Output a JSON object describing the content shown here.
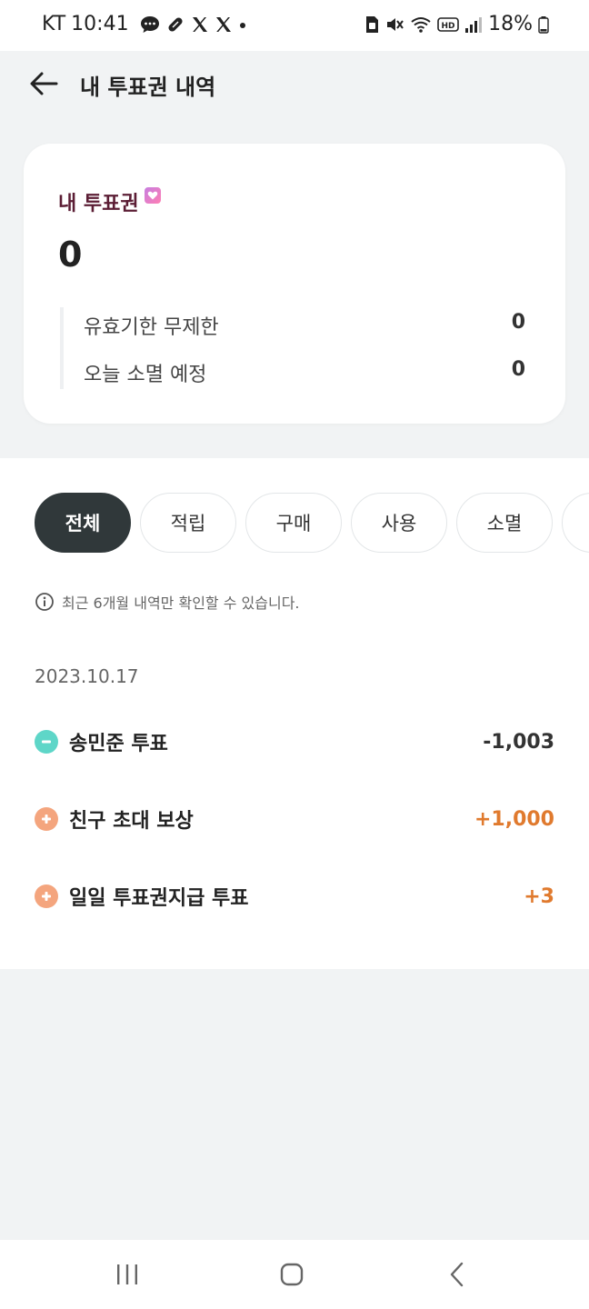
{
  "status_bar": {
    "carrier": "KT",
    "time": "10:41",
    "battery": "18%"
  },
  "header": {
    "title": "내 투표권 내역"
  },
  "summary": {
    "label": "내 투표권",
    "total": "0",
    "rows": [
      {
        "label": "유효기한 무제한",
        "value": "0"
      },
      {
        "label": "오늘 소멸 예정",
        "value": "0"
      }
    ]
  },
  "filters": {
    "tabs": [
      {
        "label": "전체",
        "active": true
      },
      {
        "label": "적립",
        "active": false
      },
      {
        "label": "구매",
        "active": false
      },
      {
        "label": "사용",
        "active": false
      },
      {
        "label": "소멸",
        "active": false
      }
    ]
  },
  "notice": "최근 6개월 내역만 확인할 수 있습니다.",
  "history": {
    "date": "2023.10.17",
    "entries": [
      {
        "label": "송민준 투표",
        "amount": "-1,003",
        "kind": "minus"
      },
      {
        "label": "친구 초대 보상",
        "amount": "+1,000",
        "kind": "plus"
      },
      {
        "label": "일일 투표권지급 투표",
        "amount": "+3",
        "kind": "plus"
      }
    ]
  },
  "colors": {
    "minus": "#5ed6c8",
    "plus": "#f4a57e",
    "plus_text": "#e07a2e",
    "minus_text": "#333333",
    "active_tab": "#30383a"
  }
}
